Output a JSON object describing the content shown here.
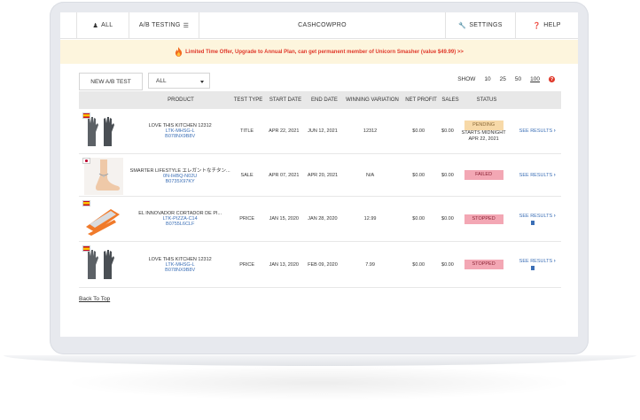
{
  "nav": {
    "all_label": "ALL",
    "ab_testing_label": "A/B TESTING",
    "brand": "CASHCOWPRO",
    "settings_label": "SETTINGS",
    "help_label": "HELP"
  },
  "banner": {
    "text": "Limited Time Offer, Upgrade to Annual Plan, can get permanent member of Unicorn Smasher (value $49.99) >>"
  },
  "controls": {
    "new_ab_test_label": "NEW A/B TEST",
    "filter_selected": "ALL",
    "show_label": "SHOW",
    "page_size_options": [
      "10",
      "25",
      "50",
      "100"
    ],
    "page_size_selected": "100"
  },
  "table": {
    "headers": {
      "product": "PRODUCT",
      "test_type": "TEST TYPE",
      "start_date": "START DATE",
      "end_date": "END DATE",
      "winning_variation": "WINNING VARIATION",
      "net_profit": "NET PROFIT",
      "sales": "SALES",
      "status": "STATUS"
    },
    "rows": [
      {
        "product_name": "LOVE THIS KITCHEN 12312",
        "sku": "LTK-MHSG-L",
        "asin": "B078NX9B8V",
        "test_type": "TITLE",
        "start_date": "APR 22, 2021",
        "end_date": "JUN 12, 2021",
        "winning_variation": "12312",
        "net_profit": "$0.00",
        "sales": "$0.00",
        "status": "PENDING",
        "status_sub_1": "STARTS MIDNIGHT",
        "status_sub_2": "APR 22, 2021",
        "link": "SEE RESULTS"
      },
      {
        "product_name": "SMARTER LIFESTYLE エレガントなチタン...",
        "sku": "0N-IHBQ-N02U",
        "asin": "B0735X97KY",
        "test_type": "SALE",
        "start_date": "APR 07, 2021",
        "end_date": "APR 20, 2021",
        "winning_variation": "N/A",
        "net_profit": "$0.00",
        "sales": "$0.00",
        "status": "FAILED",
        "link": "SEE RESULTS"
      },
      {
        "product_name": "EL INNOVADOR CORTADOR DE PI...",
        "sku": "LTK-PIZZA-C14",
        "asin": "B0755L6CLF",
        "test_type": "PRICE",
        "start_date": "JAN 15, 2020",
        "end_date": "JAN 28, 2020",
        "winning_variation": "12.99",
        "net_profit": "$0.00",
        "sales": "$0.00",
        "status": "STOPPED",
        "link": "SEE RESULTS"
      },
      {
        "product_name": "LOVE THIS KITCHEN 12312",
        "sku": "LTK-MHSG-L",
        "asin": "B078NX9B8V",
        "test_type": "PRICE",
        "start_date": "JAN 13, 2020",
        "end_date": "FEB 09, 2020",
        "winning_variation": "7.99",
        "net_profit": "$0.00",
        "sales": "$0.00",
        "status": "STOPPED",
        "link": "SEE RESULTS"
      }
    ]
  },
  "footer": {
    "back_to_top": "Back To Top"
  },
  "colors": {
    "banner_bg": "#fdf5dd",
    "banner_text": "#e0392b",
    "link": "#3b6fb6",
    "pending": "#f7d9a8",
    "failed": "#f3a7b4",
    "stopped": "#f3a7b4"
  }
}
